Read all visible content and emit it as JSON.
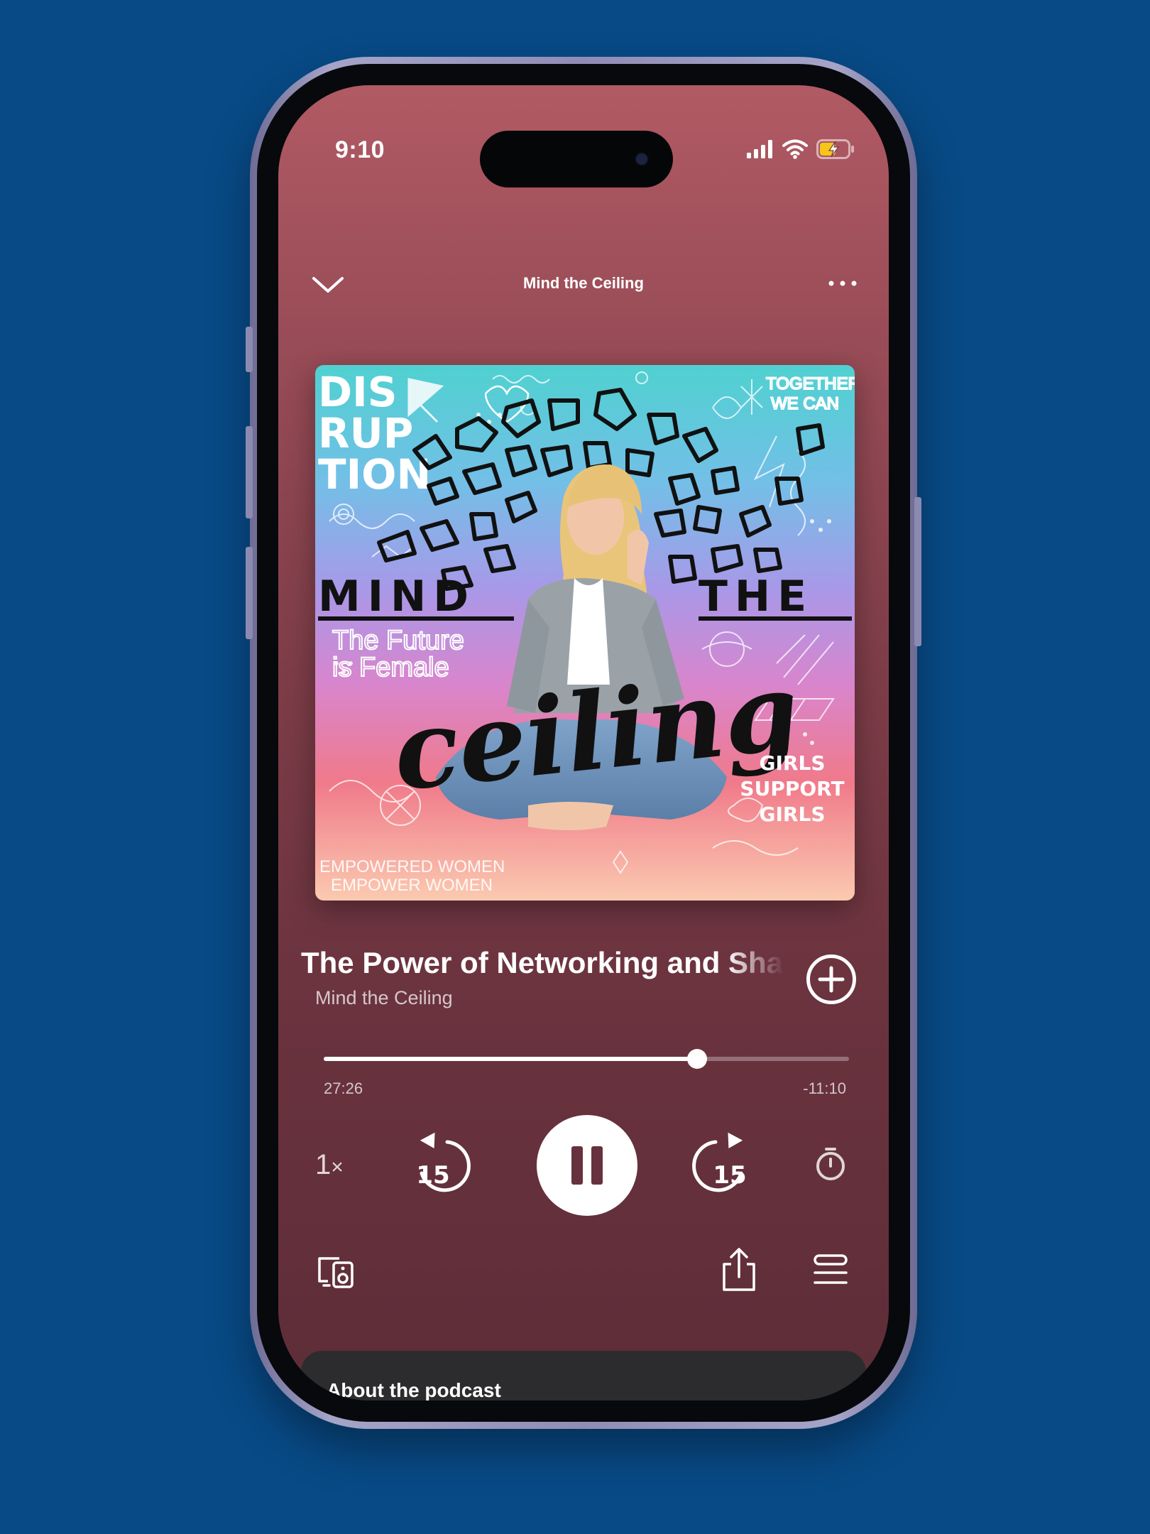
{
  "status_bar": {
    "time": "9:10",
    "icons": [
      "signal-bars-icon",
      "wifi-icon",
      "battery-charging-icon"
    ],
    "battery_color": "#f5c518"
  },
  "header": {
    "title": "Mind the Ceiling",
    "collapse_icon": "chevron-down-icon",
    "more_icon": "more-horizontal-icon"
  },
  "cover_art": {
    "words": {
      "top_left": [
        "DIS",
        "RUP",
        "TION"
      ],
      "top_right": [
        "TOGETHER",
        "WE CAN"
      ],
      "mind": "MIND",
      "the": "THE",
      "ceiling": "ceiling",
      "future": [
        "The Future",
        "is Female"
      ],
      "girls": [
        "GIRLS",
        "SUPPORT",
        "GIRLS"
      ],
      "empowered": [
        "EMPOWERED WOMEN",
        "EMPOWER WOMEN"
      ]
    },
    "palette": [
      "#4fd1d0",
      "#8ea6ea",
      "#c788e0",
      "#f07a90",
      "#f7a98a"
    ]
  },
  "episode": {
    "title": "The Power of Networking and Sha",
    "show": "Mind the Ceiling"
  },
  "playback": {
    "elapsed": "27:26",
    "remaining": "-11:10",
    "progress_fraction": 0.711,
    "speed": "1",
    "speed_suffix": "×",
    "skip_back_seconds": "15",
    "skip_forward_seconds": "15",
    "state": "playing"
  },
  "actions": {
    "device_icon": "connect-device-icon",
    "share_icon": "share-icon",
    "queue_icon": "queue-icon",
    "add_icon": "add-circle-icon",
    "timer_icon": "sleep-timer-icon"
  },
  "about": {
    "title": "About the podcast"
  },
  "colors": {
    "background": "#084a86",
    "screen_top": "#b15a64",
    "screen_bottom": "#5d2d38",
    "card": "#2c2c2e"
  }
}
